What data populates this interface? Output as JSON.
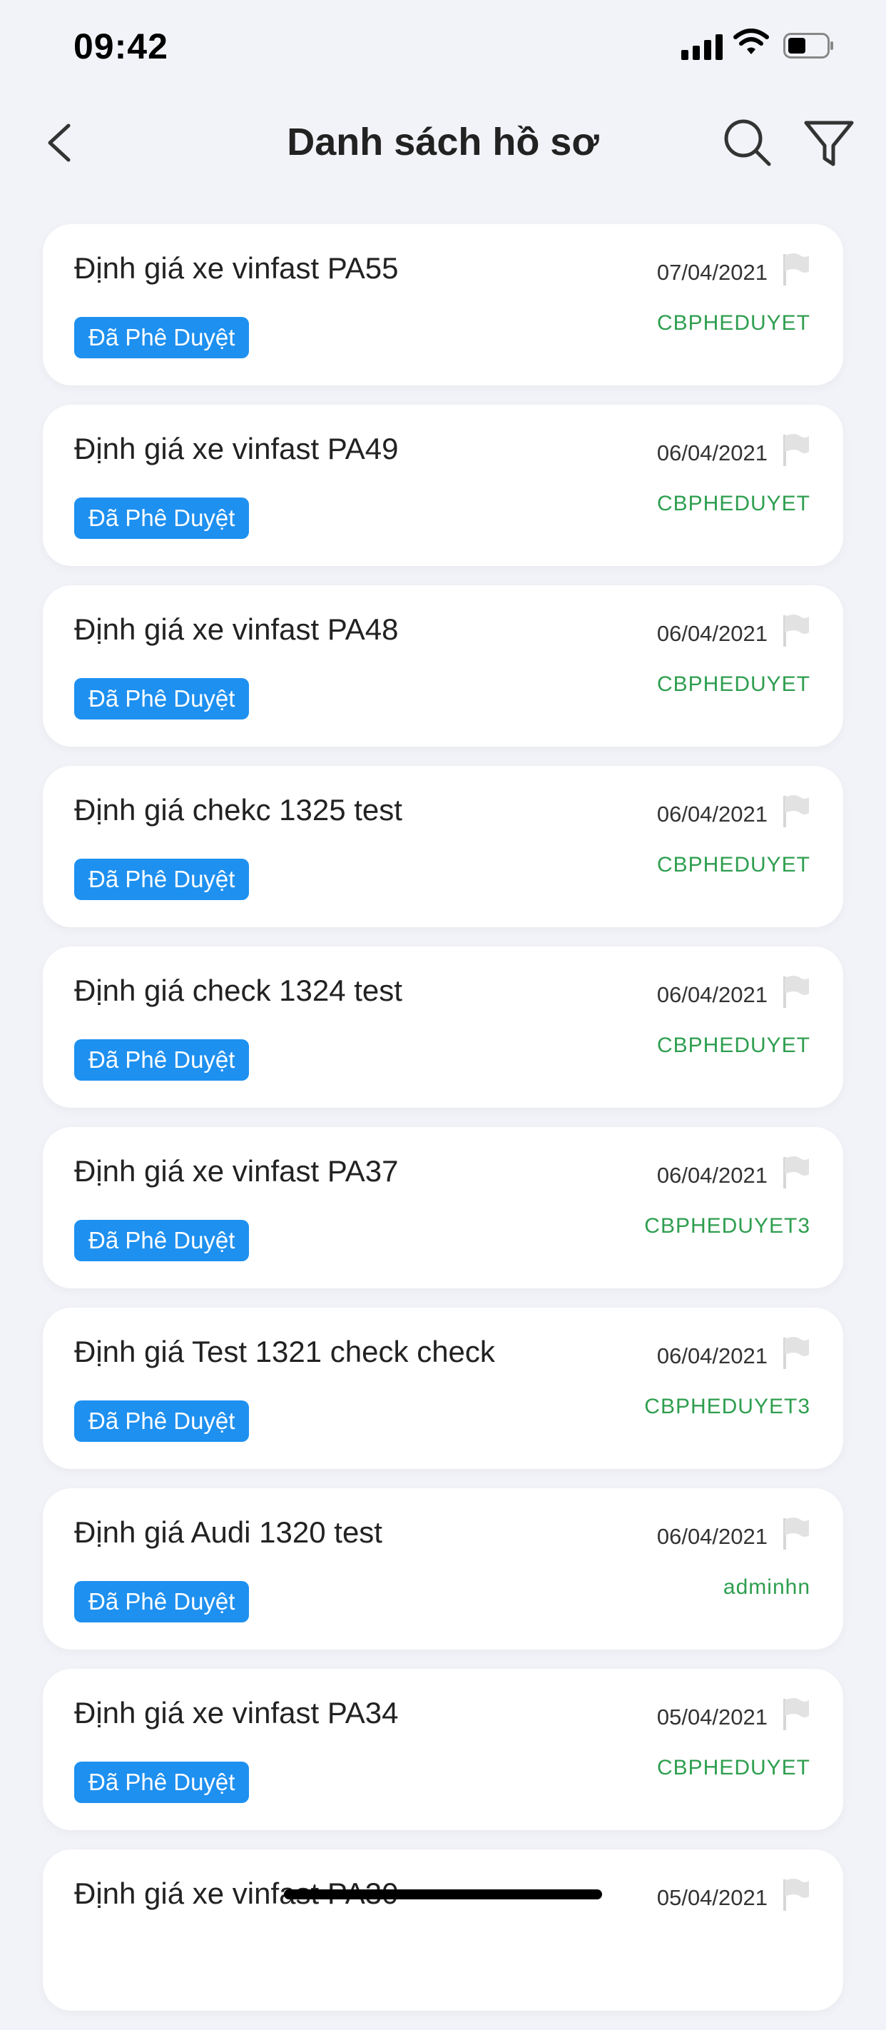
{
  "status": {
    "time": "09:42"
  },
  "header": {
    "title": "Danh sách hồ sơ"
  },
  "colors": {
    "badge": "#1E90F0",
    "user": "#2E9E4F",
    "background": "#F2F3F8"
  },
  "items": [
    {
      "title": "Định giá xe vinfast PA55",
      "date": "07/04/2021",
      "status": "Đã Phê Duyệt",
      "user": "CBPHEDUYET"
    },
    {
      "title": "Định giá xe vinfast PA49",
      "date": "06/04/2021",
      "status": "Đã Phê Duyệt",
      "user": "CBPHEDUYET"
    },
    {
      "title": "Định giá xe vinfast PA48",
      "date": "06/04/2021",
      "status": "Đã Phê Duyệt",
      "user": "CBPHEDUYET"
    },
    {
      "title": "Định giá chekc 1325 test",
      "date": "06/04/2021",
      "status": "Đã Phê Duyệt",
      "user": "CBPHEDUYET"
    },
    {
      "title": "Định giá check 1324 test",
      "date": "06/04/2021",
      "status": "Đã Phê Duyệt",
      "user": "CBPHEDUYET"
    },
    {
      "title": "Định giá xe vinfast PA37",
      "date": "06/04/2021",
      "status": "Đã Phê Duyệt",
      "user": "CBPHEDUYET3"
    },
    {
      "title": "Định giá Test 1321 check check",
      "date": "06/04/2021",
      "status": "Đã Phê Duyệt",
      "user": "CBPHEDUYET3"
    },
    {
      "title": "Định giá Audi 1320 test",
      "date": "06/04/2021",
      "status": "Đã Phê Duyệt",
      "user": "adminhn"
    },
    {
      "title": "Định giá xe vinfast PA34",
      "date": "05/04/2021",
      "status": "Đã Phê Duyệt",
      "user": "CBPHEDUYET"
    },
    {
      "title": "Định giá xe vinfast PA30",
      "date": "05/04/2021",
      "status": "",
      "user": ""
    }
  ]
}
